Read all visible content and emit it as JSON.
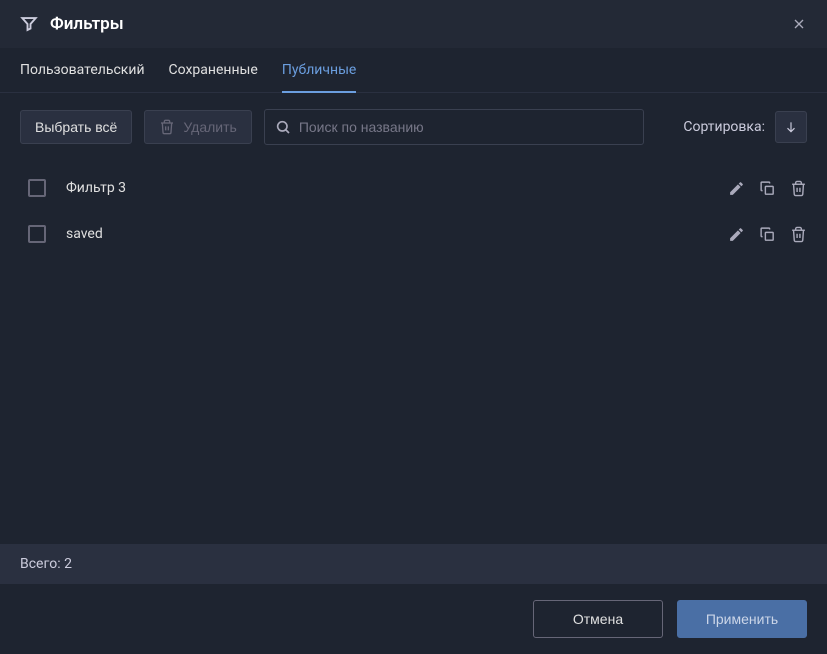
{
  "header": {
    "title": "Фильтры"
  },
  "tabs": [
    {
      "label": "Пользовательский",
      "active": false
    },
    {
      "label": "Сохраненные",
      "active": false
    },
    {
      "label": "Публичные",
      "active": true
    }
  ],
  "toolbar": {
    "selectAll": "Выбрать всё",
    "delete": "Удалить",
    "searchPlaceholder": "Поиск по названию",
    "sortLabel": "Сортировка:"
  },
  "filters": [
    {
      "name": "Фильтр 3"
    },
    {
      "name": "saved"
    }
  ],
  "footer": {
    "total": "Всего: 2",
    "cancel": "Отмена",
    "apply": "Применить"
  }
}
